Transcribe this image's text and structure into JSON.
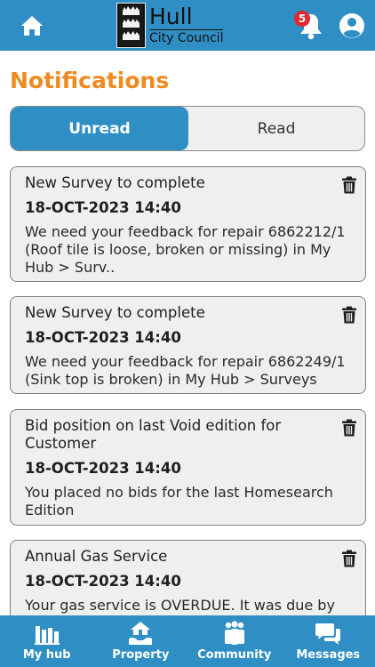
{
  "header": {
    "logo_line1": "Hull",
    "logo_line2": "City Council",
    "notification_count": "5",
    "icons": {
      "home": "home-icon",
      "bell": "bell-icon",
      "user": "user-icon"
    }
  },
  "page": {
    "title": "Notifications",
    "tabs": [
      {
        "label": "Unread",
        "active": true
      },
      {
        "label": "Read",
        "active": false
      }
    ]
  },
  "notifications": [
    {
      "title": "New Survey to complete",
      "date": "18-OCT-2023 14:40",
      "body": "We need your feedback for repair 6862212/1 (Roof tile is loose, broken or missing) in My Hub > Surv.."
    },
    {
      "title": "New Survey to complete",
      "date": "18-OCT-2023 14:40",
      "body": "We need your feedback for repair 6862249/1 (Sink top is broken) in My Hub > Surveys"
    },
    {
      "title": "Bid position on last Void edition for Customer",
      "date": "18-OCT-2023 14:40",
      "body": "You placed no bids for the last Homesearch Edition"
    },
    {
      "title": "Annual Gas Service",
      "date": "18-OCT-2023 14:40",
      "body": "Your gas service is OVERDUE. It was due by"
    }
  ],
  "bottom_nav": [
    {
      "label": "My hub",
      "icon": "my-hub-icon"
    },
    {
      "label": "Property",
      "icon": "property-icon"
    },
    {
      "label": "Community",
      "icon": "community-icon"
    },
    {
      "label": "Messages",
      "icon": "messages-icon"
    }
  ],
  "colors": {
    "brand_blue": "#2f8fc5",
    "title_orange": "#ef8a1f",
    "badge_red": "#e3262f",
    "card_bg": "#efefef"
  }
}
